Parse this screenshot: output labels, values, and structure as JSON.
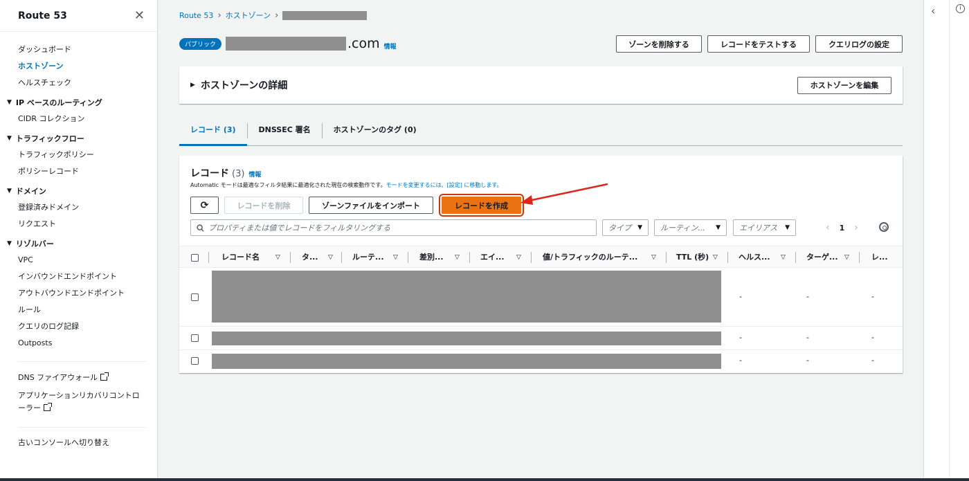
{
  "sidebar": {
    "title": "Route 53",
    "top_items": [
      "ダッシュボード",
      "ホストゾーン",
      "ヘルスチェック"
    ],
    "active_item": "ホストゾーン",
    "sections": [
      {
        "label": "IP ベースのルーティング",
        "items": [
          "CIDR コレクション"
        ]
      },
      {
        "label": "トラフィックフロー",
        "items": [
          "トラフィックポリシー",
          "ポリシーレコード"
        ]
      },
      {
        "label": "ドメイン",
        "items": [
          "登録済みドメイン",
          "リクエスト"
        ]
      },
      {
        "label": "リゾルバー",
        "items": [
          "VPC",
          "インバウンドエンドポイント",
          "アウトバウンドエンドポイント",
          "ルール",
          "クエリのログ記録",
          "Outposts"
        ]
      }
    ],
    "external_links": [
      "DNS ファイアウォール",
      "アプリケーションリカバリコントローラー"
    ],
    "footer_link": "古いコンソールへ切り替え"
  },
  "breadcrumb": [
    "Route 53",
    "ホストゾーン"
  ],
  "zone": {
    "badge": "パブリック",
    "domain_suffix": ".com",
    "info": "情報"
  },
  "top_buttons": [
    "ゾーンを削除する",
    "レコードをテストする",
    "クエリログの設定"
  ],
  "details": {
    "title": "ホストゾーンの詳細",
    "edit_button": "ホストゾーンを編集"
  },
  "tabs": [
    "レコード (3)",
    "DNSSEC 署名",
    "ホストゾーンのタグ (0)"
  ],
  "records": {
    "title": "レコード",
    "count": "(3)",
    "info": "情報",
    "description": "Automatic モードは最適なフィルタ結果に最適化された現在の検索動作です。",
    "description_link": "モードを変更するには、[設定] に移動します。",
    "buttons": {
      "delete": "レコードを削除",
      "import": "ゾーンファイルをインポート",
      "create": "レコードを作成"
    },
    "search_placeholder": "プロパティまたは値でレコードをフィルタリングする",
    "filters": [
      "タイプ",
      "ルーティン...",
      "エイリアス"
    ],
    "page": "1",
    "columns": [
      "レコード名",
      "タ...",
      "ルーテ...",
      "差別...",
      "エイ...",
      "値/トラフィックのルーテ...",
      "TTL (秒)",
      "ヘルス...",
      "ターゲ...",
      "レ..."
    ],
    "rows": [
      {
        "health": "-",
        "target": "-",
        "last": "-"
      },
      {
        "health": "-",
        "target": "-",
        "last": "-"
      },
      {
        "health": "-",
        "target": "-",
        "last": "-"
      }
    ]
  },
  "colors": {
    "accent": "#0073bb",
    "primary_button": "#ec7211",
    "highlight": "#d13212"
  }
}
